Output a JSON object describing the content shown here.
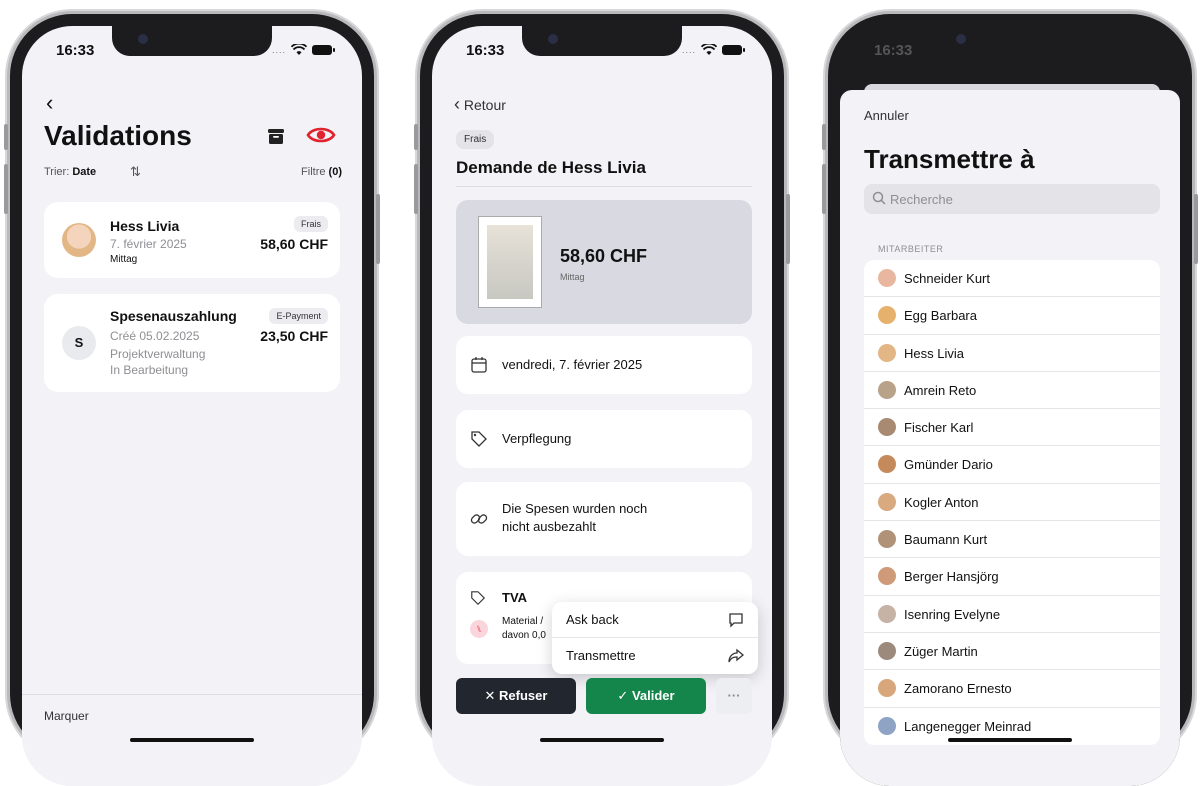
{
  "phone1": {
    "time": "16:33",
    "title": "Validations",
    "sort_label": "Trier:",
    "sort_value": "Date",
    "filter_label": "Filtre",
    "filter_count": "(0)",
    "items": [
      {
        "name": "Hess Livia",
        "date": "7. février 2025",
        "note": "Mittag",
        "tag": "Frais",
        "amount": "58,60 CHF"
      },
      {
        "name": "Spesenauszahlung",
        "initial": "S",
        "created": "Créé 05.02.2025",
        "project": "Projektverwaltung",
        "status": "In Bearbeitung",
        "tag": "E-Payment",
        "amount": "23,50 CHF"
      }
    ],
    "bottom_label": "Marquer",
    "accent": "#e0232e"
  },
  "phone2": {
    "time": "16:33",
    "back_label": "Retour",
    "category": "Frais",
    "title": "Demande de Hess Livia",
    "amount": "58,60 CHF",
    "amount_sub": "Mittag",
    "date": "vendredi, 7. février 2025",
    "category_tag": "Verpflegung",
    "payment_line1": "Die Spesen wurden noch",
    "payment_line2": "nicht ausbezahlt",
    "tva_label": "TVA",
    "tva_line1": "Material /",
    "tva_line2": "davon 0,0",
    "menu": [
      {
        "label": "Ask back",
        "icon": "chat-bubble-icon"
      },
      {
        "label": "Transmettre",
        "icon": "share-forward-icon"
      }
    ],
    "refuse_label": "Refuser",
    "validate_label": "Valider",
    "more_label": "···"
  },
  "phone3": {
    "time": "16:33",
    "cancel_label": "Annuler",
    "title": "Transmettre à",
    "search_placeholder": "Recherche",
    "section": "MITARBEITER",
    "people": [
      "Schneider Kurt",
      "Egg Barbara",
      "Hess Livia",
      "Amrein Reto",
      "Fischer Karl",
      "Gmünder Dario",
      "Kogler Anton",
      "Baumann Kurt",
      "Berger Hansjörg",
      "Isenring Evelyne",
      "Züger Martin",
      "Zamorano Ernesto",
      "Langenegger Meinrad"
    ]
  }
}
